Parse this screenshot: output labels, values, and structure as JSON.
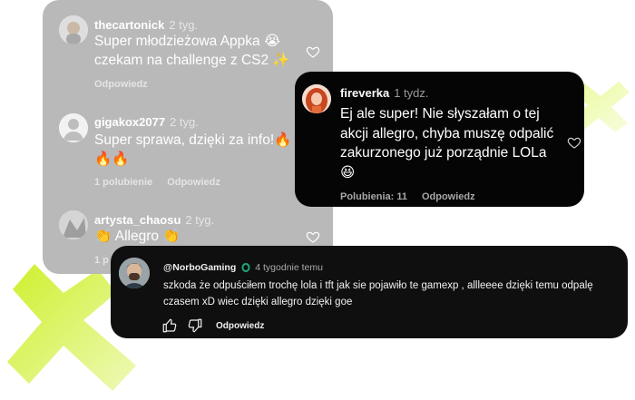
{
  "colors": {
    "gray_card": "#b9b9b9",
    "black_card": "#050505",
    "yt_card": "#0f0f0f",
    "accent_green": "#d9f45a"
  },
  "gray_comments": [
    {
      "user": "thecartonick",
      "time": "2 tyg.",
      "text": "Super młodzieżowa Appka 😭 czekam na challenge z CS2 ✨",
      "reply": "Odpowiedz"
    },
    {
      "user": "gigakox2077",
      "time": "2 tyg.",
      "text": "Super sprawa, dzięki za info!🔥🔥🔥",
      "likes": "1 polubienie",
      "reply": "Odpowiedz"
    },
    {
      "user": "artysta_chaosu",
      "time": "2 tyg.",
      "text": "👏 Allegro 👏",
      "likes": "1 p"
    }
  ],
  "featured_comment": {
    "user": "fireverka",
    "time": "1 tydz.",
    "text": "Ej ale super! Nie słyszałam o tej akcji allegro, chyba muszę odpalić zakurzonego już porządnie LOLa 😆",
    "likes": "Polubienia: 11",
    "reply": "Odpowiedz"
  },
  "youtube_comment": {
    "user": "@NorboGaming",
    "time": "4 tygodnie temu",
    "text": "szkoda że odpuściłem trochę lola i tft jak sie pojawiło te gamexp , allleeee dzięki temu odpalę czasem xD wiec dzięki allegro dzięki goe",
    "reply": "Odpowiedz"
  },
  "icons": {
    "like": "heart-icon",
    "thumb_up": "thumb-up-icon",
    "thumb_down": "thumb-down-icon",
    "badge": "member-badge-icon"
  }
}
